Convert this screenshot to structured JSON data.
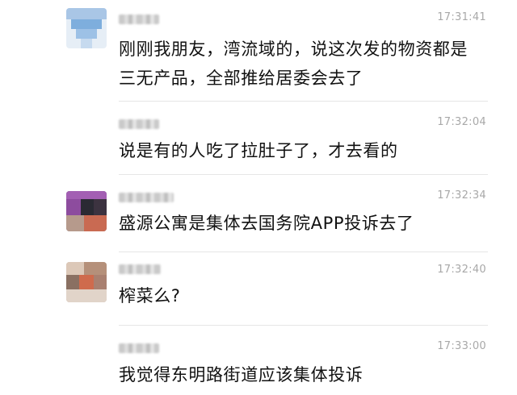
{
  "messages": [
    {
      "time": "17:31:41",
      "lines": [
        "刚刚我朋友，湾流域的，说这次发的物资都是",
        "三无产品，全部推给居委会去了"
      ]
    },
    {
      "time": "17:32:04",
      "lines": [
        "说是有的人吃了拉肚子了，才去看的"
      ]
    },
    {
      "time": "17:32:34",
      "lines": [
        "盛源公寓是集体去国务院APP投诉去了"
      ]
    },
    {
      "time": "17:32:40",
      "lines": [
        "榨菜么?"
      ]
    },
    {
      "time": "17:33:00",
      "lines": [
        "我觉得东明路街道应该集体投诉"
      ]
    }
  ]
}
